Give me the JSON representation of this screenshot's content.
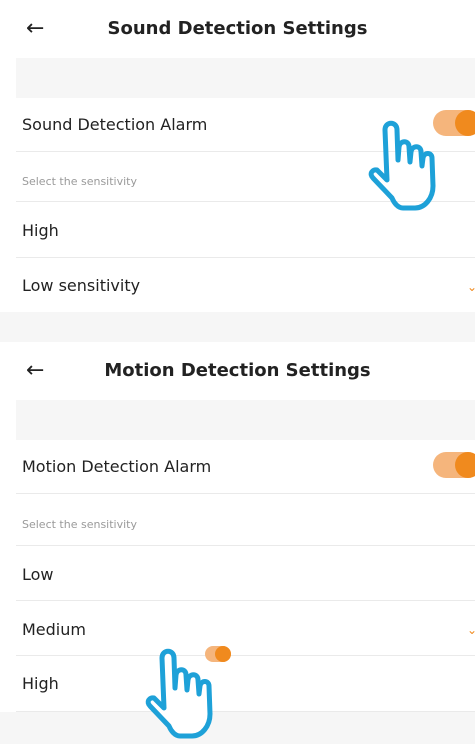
{
  "colors": {
    "accent": "#f08a1e",
    "hand": "#1ea1d8",
    "divider": "#eaeaea",
    "gap": "#f6f6f6"
  },
  "sound": {
    "title": "Sound Detection Settings",
    "alarm_label": "Sound Detection Alarm",
    "alarm_on": true,
    "hint": "Select the sensitivity",
    "options": [
      "High",
      "Low sensitivity"
    ],
    "selected": "Low sensitivity"
  },
  "motion": {
    "title": "Motion Detection Settings",
    "alarm_label": "Motion Detection Alarm",
    "alarm_on": true,
    "hint": "Select the sensitivity",
    "options": [
      "Low",
      "Medium",
      "High"
    ],
    "selected": "Medium"
  },
  "icons": {
    "back": "arrow-left-icon",
    "pointer": "pointing-hand-icon",
    "check": "chevron-check-icon"
  }
}
